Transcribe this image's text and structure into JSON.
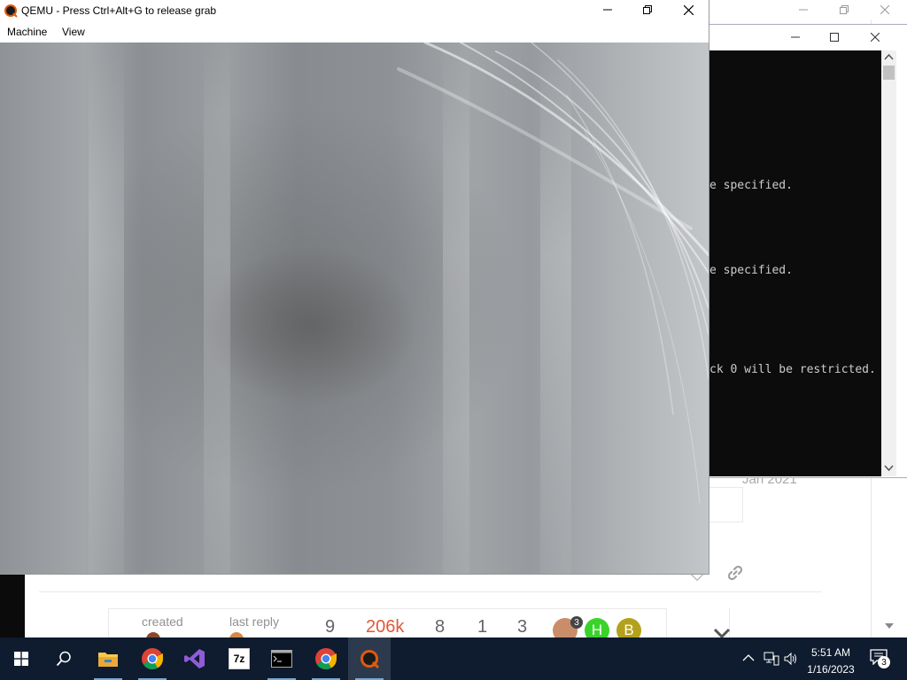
{
  "qemu": {
    "title": "QEMU - Press Ctrl+Alt+G to release grab",
    "menus": [
      "Machine",
      "View"
    ]
  },
  "console": {
    "lines": [
      "e specified.",
      "e specified.",
      "ck 0 will be restricted."
    ]
  },
  "browser_page": {
    "post_date": "Jan 2021",
    "topic_map": {
      "created_label": "created",
      "last_reply_label": "last reply",
      "stats": [
        "9",
        "206k",
        "8",
        "1",
        "3"
      ],
      "avatar_badge": "3",
      "avatar_letters": [
        "H",
        "B"
      ]
    }
  },
  "taskbar": {
    "time": "5:51 AM",
    "date": "1/16/2023",
    "notification_count": "3",
    "app_icons": [
      "windows-start-icon",
      "search-icon",
      "file-explorer-icon",
      "chrome-icon",
      "visual-studio-icon",
      "7zip-icon",
      "terminal-icon",
      "chrome-icon",
      "qemu-icon"
    ],
    "sevenzip_label": "7z"
  },
  "colors": {
    "taskbar": "#0f1b2e",
    "accent_orange": "#e45735",
    "avatar_green": "#3ad32a",
    "avatar_olive": "#b3a11c"
  }
}
